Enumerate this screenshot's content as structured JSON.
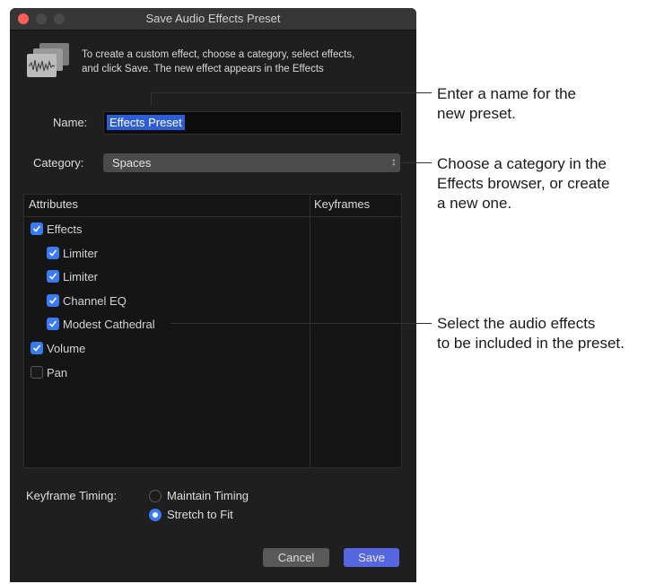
{
  "window": {
    "title": "Save Audio Effects Preset"
  },
  "info": {
    "icon": "audio-waveform-icon",
    "line1": "To create a custom effect, choose a category, select effects,",
    "line2": "and click Save. The new effect appears in the Effects"
  },
  "name": {
    "label": "Name:",
    "value": "Effects Preset"
  },
  "category": {
    "label": "Category:",
    "value": "Spaces",
    "arrows": "⌃⌄"
  },
  "table": {
    "headers": {
      "attributes": "Attributes",
      "keyframes": "Keyframes"
    },
    "rows": [
      {
        "label": "Effects",
        "checked": true,
        "indent": 0
      },
      {
        "label": "Limiter",
        "checked": true,
        "indent": 1
      },
      {
        "label": "Limiter",
        "checked": true,
        "indent": 1
      },
      {
        "label": "Channel EQ",
        "checked": true,
        "indent": 1
      },
      {
        "label": "Modest Cathedral",
        "checked": true,
        "indent": 1
      },
      {
        "label": "Volume",
        "checked": true,
        "indent": 0
      },
      {
        "label": "Pan",
        "checked": false,
        "indent": 0
      }
    ]
  },
  "timing": {
    "label": "Keyframe Timing:",
    "options": [
      {
        "label": "Maintain Timing",
        "selected": false
      },
      {
        "label": "Stretch to Fit",
        "selected": true
      }
    ]
  },
  "buttons": {
    "cancel": "Cancel",
    "save": "Save"
  },
  "callouts": {
    "name": [
      "Enter a name for the",
      "new preset."
    ],
    "category": [
      "Choose a category in the",
      "Effects browser, or create",
      "a new one."
    ],
    "effects": [
      "Select the audio effects",
      "to be included in the preset."
    ]
  },
  "colors": {
    "accent": "#3a7af5",
    "save_button": "#5567e0",
    "selection": "#2d5dd7",
    "close_button": "#ff5f57"
  }
}
